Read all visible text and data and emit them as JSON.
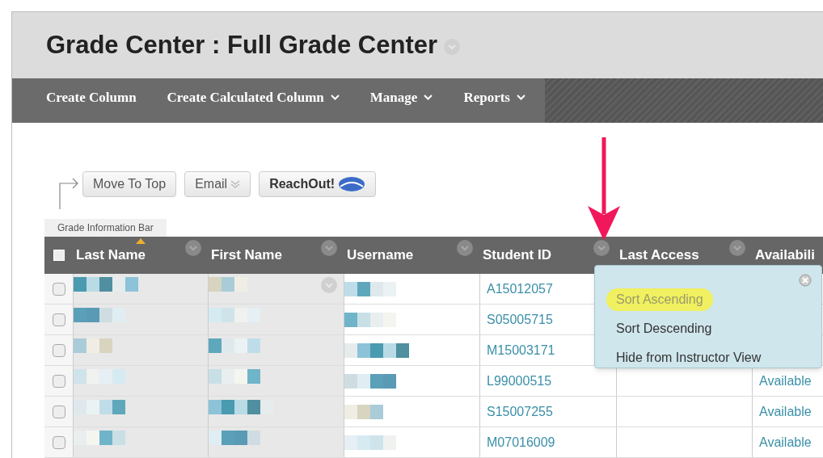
{
  "page_title": "Grade Center : Full Grade Center",
  "nav": [
    {
      "label": "Create Column",
      "dropdown": false
    },
    {
      "label": "Create Calculated Column",
      "dropdown": true
    },
    {
      "label": "Manage",
      "dropdown": true
    },
    {
      "label": "Reports",
      "dropdown": true
    }
  ],
  "actions": [
    {
      "label": "Move To Top",
      "kind": "plain"
    },
    {
      "label": "Email",
      "kind": "menu"
    },
    {
      "label": "ReachOut!",
      "kind": "logo"
    }
  ],
  "info_bar_tab": "Grade Information Bar",
  "table": {
    "select_all": {
      "checked": false
    },
    "columns": [
      {
        "label": "Last Name",
        "sorted": true
      },
      {
        "label": "First Name",
        "sorted": false
      },
      {
        "label": "Username",
        "sorted": false
      },
      {
        "label": "Student ID",
        "sorted": false
      },
      {
        "label": "Last Access",
        "sorted": false
      },
      {
        "label": "Availabili",
        "sorted": false
      }
    ],
    "rows": [
      {
        "checked": false,
        "has_menu": true,
        "student_id": "A15012057"
      },
      {
        "checked": false,
        "has_menu": false,
        "student_id": "S05005715"
      },
      {
        "checked": false,
        "has_menu": false,
        "student_id": "M15003171"
      },
      {
        "checked": false,
        "has_menu": false,
        "student_id": "L99000515",
        "availability": "Available"
      },
      {
        "checked": false,
        "has_menu": false,
        "student_id": "S15007255",
        "availability": "Available"
      },
      {
        "checked": false,
        "has_menu": false,
        "student_id": "M07016009",
        "availability": "Available"
      }
    ]
  },
  "column_menu": {
    "items": [
      {
        "label": "Sort Ascending",
        "highlighted": true
      },
      {
        "label": "Sort Descending",
        "highlighted": false
      },
      {
        "label": "Hide from Instructor View",
        "highlighted": false
      }
    ]
  }
}
